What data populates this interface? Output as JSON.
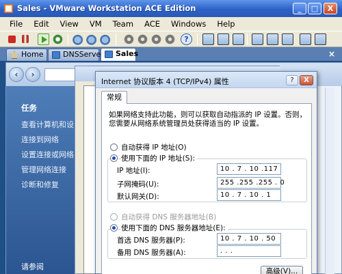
{
  "window": {
    "title": "Sales - VMware Workstation ACE Edition",
    "minimize": "_",
    "maximize": "□",
    "close": "X"
  },
  "menu": [
    "File",
    "Edit",
    "View",
    "VM",
    "Team",
    "ACE",
    "Windows",
    "Help"
  ],
  "tabs": [
    {
      "label": "Home",
      "icon": "home-icon"
    },
    {
      "label": "DNSServer",
      "icon": "vm-icon"
    },
    {
      "label": "Sales",
      "icon": "vm-icon",
      "active": true
    }
  ],
  "guest": {
    "sidebar": {
      "title": "任务",
      "items": [
        "查看计算机和设",
        "连接到网络",
        "设置连接或网络",
        "管理网络连接",
        "诊断和修复"
      ],
      "footer": "请参阅"
    }
  },
  "dialog": {
    "title": "Internet 协议版本 4 (TCP/IPv4) 属性",
    "help": "?",
    "close": "X",
    "tab": "常规",
    "description_line1": "如果网络支持此功能，则可以获取自动指派的 IP 设置。否则，",
    "description_line2": "您需要从网络系统管理员处获得适当的 IP 设置。",
    "ip_section": {
      "auto_label": "自动获得 IP 地址(O)",
      "manual_label": "使用下面的 IP 地址(S):",
      "selected": "manual",
      "fields": [
        {
          "label": "IP 地址(I):",
          "value": "10 . 7 . 10 .117"
        },
        {
          "label": "子网掩码(U):",
          "value": "255 .255 .255 . 0"
        },
        {
          "label": "默认网关(D):",
          "value": "10 . 7 . 10 . 1"
        }
      ]
    },
    "dns_section": {
      "auto_label": "自动获得 DNS 服务器地址(B)",
      "manual_label": "使用下面的 DNS 服务器地址(E):",
      "selected": "manual",
      "fields": [
        {
          "label": "首选 DNS 服务器(P):",
          "value": "10 . 7 . 10 . 50"
        },
        {
          "label": "备用 DNS 服务器(A):",
          "value": " .  .  . "
        }
      ]
    },
    "advanced_button": "高级(V)..."
  }
}
